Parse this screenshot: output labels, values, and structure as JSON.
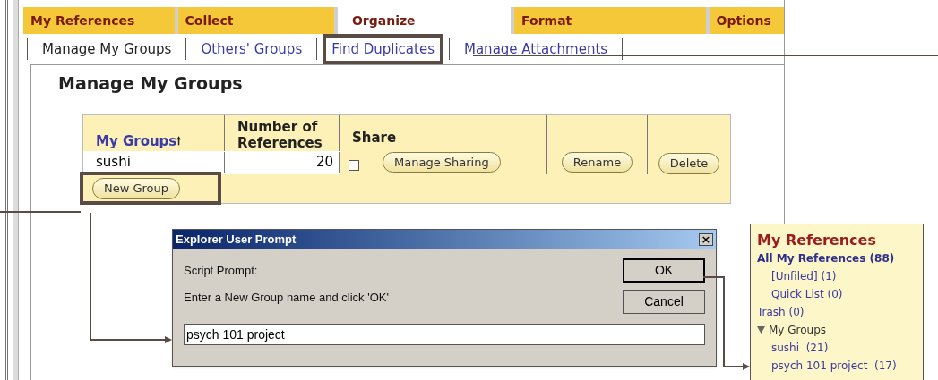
{
  "main_tabs": [
    {
      "label": "My References",
      "selected": false
    },
    {
      "label": "Collect",
      "selected": false
    },
    {
      "label": "Organize",
      "selected": true
    },
    {
      "label": "Format",
      "selected": false
    },
    {
      "label": "Options",
      "selected": false
    }
  ],
  "sub_tabs": [
    {
      "label": "Manage My Groups",
      "selected": true,
      "highlighted": false
    },
    {
      "label": "Others' Groups",
      "selected": false,
      "highlighted": false
    },
    {
      "label": "Find Duplicates",
      "selected": false,
      "highlighted": true
    },
    {
      "label": "Manage Attachments",
      "selected": false,
      "highlighted": false
    }
  ],
  "page_title": "Manage My Groups",
  "table": {
    "columns": [
      {
        "label": "My Groups",
        "sort_icon": "🠕",
        "kind": "link"
      },
      {
        "label": "Number of References",
        "kind": "text"
      },
      {
        "label": "Share",
        "kind": "text"
      }
    ],
    "rows": [
      {
        "name": "sushi",
        "count": "20",
        "shared": false,
        "buttons": [
          "Manage Sharing",
          "Rename",
          "Delete"
        ]
      }
    ],
    "new_group_button": "New Group"
  },
  "dialog": {
    "title": "Explorer User Prompt",
    "close": "×",
    "label": "Script Prompt:",
    "message": "Enter a New Group name and click 'OK'",
    "value": "psych 101 project",
    "buttons": [
      "OK",
      "Cancel"
    ]
  },
  "sidebar": {
    "title": "My References",
    "items": [
      {
        "label": "All My References (88)",
        "kind": "bold",
        "children": [
          {
            "label": "[Unfiled] (1)"
          },
          {
            "label": "Quick List (0)"
          }
        ]
      },
      {
        "label": "Trash (0)",
        "kind": "link"
      },
      {
        "label": "My Groups",
        "kind": "folder",
        "expanded": true,
        "children": [
          {
            "label": "sushi  (21)"
          },
          {
            "label": "psych 101 project  (17)"
          }
        ]
      }
    ]
  }
}
